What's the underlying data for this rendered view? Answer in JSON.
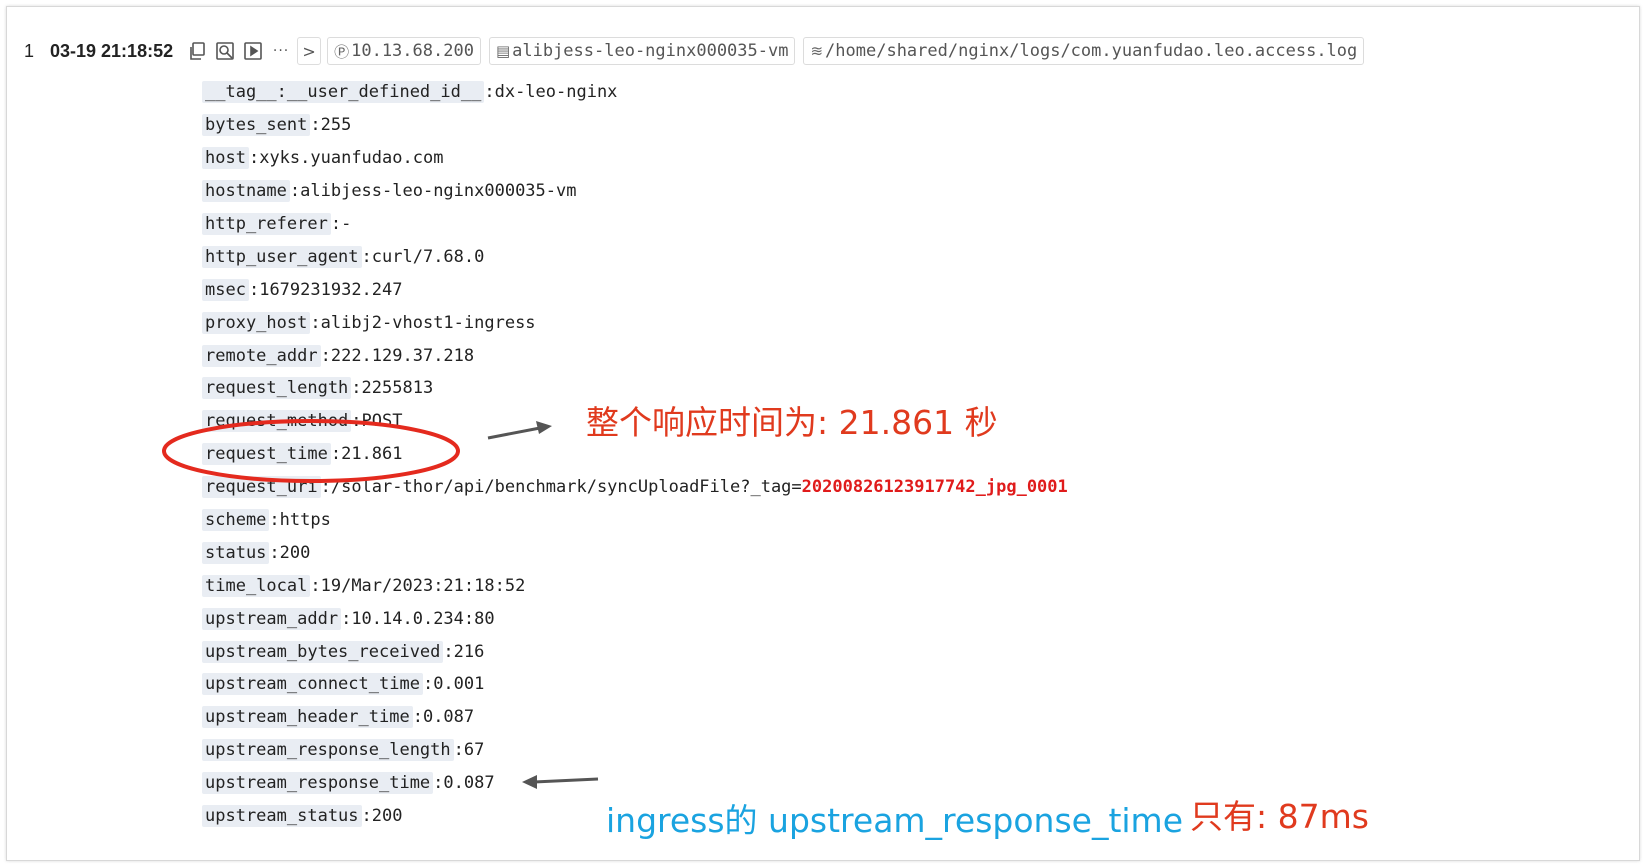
{
  "entry": {
    "index": "1",
    "time": "03-19 21:18:52",
    "ip": "10.13.68.200",
    "host_tag": "alibjess-leo-nginx000035-vm",
    "path_tag": "/home/shared/nginx/logs/com.yuanfudao.leo.access.log",
    "more_label": "···",
    "next_label": ">"
  },
  "fields": [
    {
      "key": "__tag__:__user_defined_id__",
      "val": "dx-leo-nginx"
    },
    {
      "key": "bytes_sent",
      "val": "255"
    },
    {
      "key": "host",
      "val": "xyks.yuanfudao.com"
    },
    {
      "key": "hostname",
      "val": "alibjess-leo-nginx000035-vm"
    },
    {
      "key": "http_referer",
      "val": "-"
    },
    {
      "key": "http_user_agent",
      "val": "curl/7.68.0"
    },
    {
      "key": "msec",
      "val": "1679231932.247"
    },
    {
      "key": "proxy_host",
      "val": "alibj2-vhost1-ingress"
    },
    {
      "key": "remote_addr",
      "val": "222.129.37.218"
    },
    {
      "key": "request_length",
      "val": "2255813"
    },
    {
      "key": "request_method",
      "val": "POST"
    },
    {
      "key": "request_time",
      "val": "21.861"
    },
    {
      "key": "request_uri",
      "val": "/solar-thor/api/benchmark/syncUploadFile?_tag=",
      "val_hl": "20200826123917742_jpg_0001"
    },
    {
      "key": "scheme",
      "val": "https"
    },
    {
      "key": "status",
      "val": "200"
    },
    {
      "key": "time_local",
      "val": "19/Mar/2023:21:18:52"
    },
    {
      "key": "upstream_addr",
      "val": "10.14.0.234:80"
    },
    {
      "key": "upstream_bytes_received",
      "val": "216"
    },
    {
      "key": "upstream_connect_time",
      "val": "0.001"
    },
    {
      "key": "upstream_header_time",
      "val": "0.087"
    },
    {
      "key": "upstream_response_length",
      "val": "67"
    },
    {
      "key": "upstream_response_time",
      "val": "0.087"
    },
    {
      "key": "upstream_status",
      "val": "200"
    }
  ],
  "annotations": {
    "total_time": "整个响应时间为: 21.861 秒",
    "ingress_blue": "ingress的 upstream_response_time",
    "ingress_red": "只有: 87ms"
  },
  "colors": {
    "annotation_red": "#e03a1e",
    "annotation_blue": "#1aa3e0",
    "highlight": "#e01b1b",
    "key_bg": "#e9edf3"
  },
  "icons": {
    "copy": "copy-icon",
    "context": "context-search-icon",
    "play": "play-icon"
  }
}
